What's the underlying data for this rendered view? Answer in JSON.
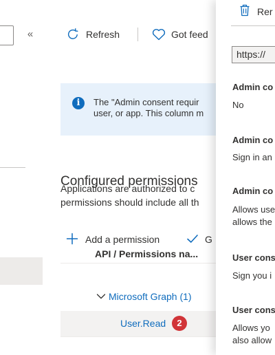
{
  "nav": {
    "collapse_glyph": "«"
  },
  "toolbar": {
    "refresh_label": "Refresh",
    "feedback_label": "Got feed",
    "refresh_icon": "refresh-icon",
    "feedback_icon": "heart-icon"
  },
  "info": {
    "line1": "The \"Admin consent requir",
    "line2": "user, or app. This column m",
    "icon": "info-icon"
  },
  "section": {
    "title": "Configured permissions",
    "desc_line1": "Applications are authorized to c",
    "desc_line2": "permissions should include all th"
  },
  "commands": {
    "add_permission": "Add a permission",
    "grant_label": "G"
  },
  "table": {
    "header_api": "API / Permissions na...",
    "group_label": "Microsoft Graph (1)",
    "permission_label": "User.Read",
    "badge": "2"
  },
  "panel": {
    "remove_label": "Rer",
    "url_value": "https://",
    "fields": [
      {
        "label": "Admin co",
        "value_lines": [
          "No"
        ]
      },
      {
        "label": "Admin co",
        "value_lines": [
          "Sign in an"
        ]
      },
      {
        "label": "Admin co",
        "value_lines": [
          "Allows use",
          "allows the"
        ]
      },
      {
        "label": "User cons",
        "value_lines": [
          "Sign you i"
        ]
      },
      {
        "label": "User cons",
        "value_lines": [
          "Allows yo",
          "also allow"
        ]
      }
    ]
  },
  "colors": {
    "accent": "#0f6cbd",
    "badge": "#d13438",
    "info_bg": "#e7f1fb"
  }
}
